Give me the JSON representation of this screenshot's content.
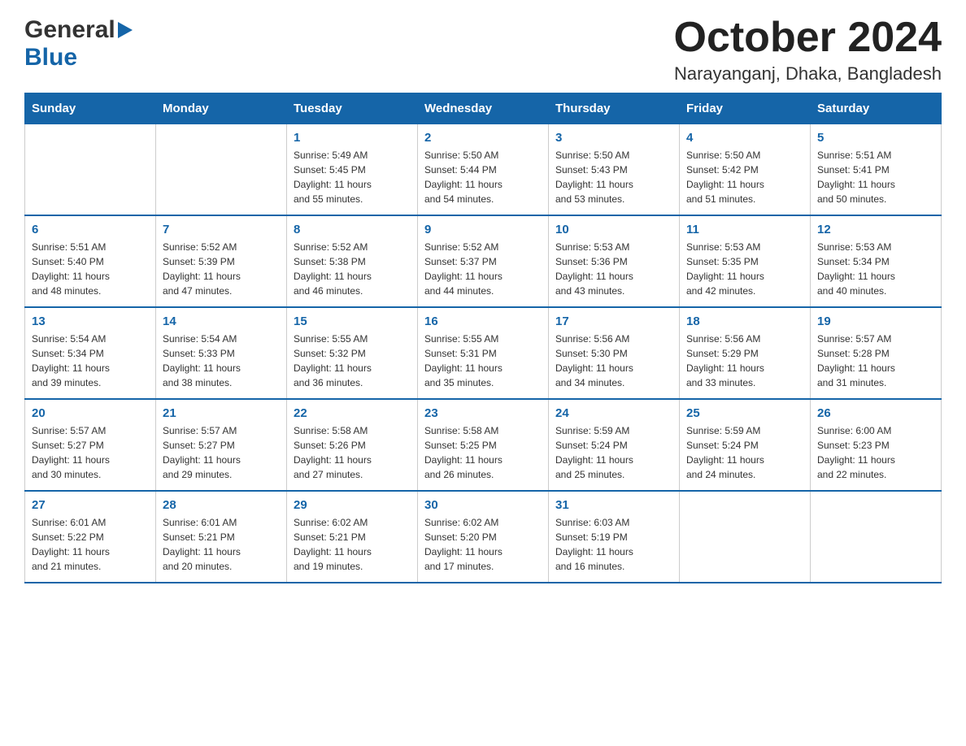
{
  "header": {
    "logo_general": "General",
    "logo_blue": "Blue",
    "month_title": "October 2024",
    "location": "Narayanganj, Dhaka, Bangladesh"
  },
  "weekdays": [
    "Sunday",
    "Monday",
    "Tuesday",
    "Wednesday",
    "Thursday",
    "Friday",
    "Saturday"
  ],
  "weeks": [
    [
      {
        "day": "",
        "info": ""
      },
      {
        "day": "",
        "info": ""
      },
      {
        "day": "1",
        "info": "Sunrise: 5:49 AM\nSunset: 5:45 PM\nDaylight: 11 hours\nand 55 minutes."
      },
      {
        "day": "2",
        "info": "Sunrise: 5:50 AM\nSunset: 5:44 PM\nDaylight: 11 hours\nand 54 minutes."
      },
      {
        "day": "3",
        "info": "Sunrise: 5:50 AM\nSunset: 5:43 PM\nDaylight: 11 hours\nand 53 minutes."
      },
      {
        "day": "4",
        "info": "Sunrise: 5:50 AM\nSunset: 5:42 PM\nDaylight: 11 hours\nand 51 minutes."
      },
      {
        "day": "5",
        "info": "Sunrise: 5:51 AM\nSunset: 5:41 PM\nDaylight: 11 hours\nand 50 minutes."
      }
    ],
    [
      {
        "day": "6",
        "info": "Sunrise: 5:51 AM\nSunset: 5:40 PM\nDaylight: 11 hours\nand 48 minutes."
      },
      {
        "day": "7",
        "info": "Sunrise: 5:52 AM\nSunset: 5:39 PM\nDaylight: 11 hours\nand 47 minutes."
      },
      {
        "day": "8",
        "info": "Sunrise: 5:52 AM\nSunset: 5:38 PM\nDaylight: 11 hours\nand 46 minutes."
      },
      {
        "day": "9",
        "info": "Sunrise: 5:52 AM\nSunset: 5:37 PM\nDaylight: 11 hours\nand 44 minutes."
      },
      {
        "day": "10",
        "info": "Sunrise: 5:53 AM\nSunset: 5:36 PM\nDaylight: 11 hours\nand 43 minutes."
      },
      {
        "day": "11",
        "info": "Sunrise: 5:53 AM\nSunset: 5:35 PM\nDaylight: 11 hours\nand 42 minutes."
      },
      {
        "day": "12",
        "info": "Sunrise: 5:53 AM\nSunset: 5:34 PM\nDaylight: 11 hours\nand 40 minutes."
      }
    ],
    [
      {
        "day": "13",
        "info": "Sunrise: 5:54 AM\nSunset: 5:34 PM\nDaylight: 11 hours\nand 39 minutes."
      },
      {
        "day": "14",
        "info": "Sunrise: 5:54 AM\nSunset: 5:33 PM\nDaylight: 11 hours\nand 38 minutes."
      },
      {
        "day": "15",
        "info": "Sunrise: 5:55 AM\nSunset: 5:32 PM\nDaylight: 11 hours\nand 36 minutes."
      },
      {
        "day": "16",
        "info": "Sunrise: 5:55 AM\nSunset: 5:31 PM\nDaylight: 11 hours\nand 35 minutes."
      },
      {
        "day": "17",
        "info": "Sunrise: 5:56 AM\nSunset: 5:30 PM\nDaylight: 11 hours\nand 34 minutes."
      },
      {
        "day": "18",
        "info": "Sunrise: 5:56 AM\nSunset: 5:29 PM\nDaylight: 11 hours\nand 33 minutes."
      },
      {
        "day": "19",
        "info": "Sunrise: 5:57 AM\nSunset: 5:28 PM\nDaylight: 11 hours\nand 31 minutes."
      }
    ],
    [
      {
        "day": "20",
        "info": "Sunrise: 5:57 AM\nSunset: 5:27 PM\nDaylight: 11 hours\nand 30 minutes."
      },
      {
        "day": "21",
        "info": "Sunrise: 5:57 AM\nSunset: 5:27 PM\nDaylight: 11 hours\nand 29 minutes."
      },
      {
        "day": "22",
        "info": "Sunrise: 5:58 AM\nSunset: 5:26 PM\nDaylight: 11 hours\nand 27 minutes."
      },
      {
        "day": "23",
        "info": "Sunrise: 5:58 AM\nSunset: 5:25 PM\nDaylight: 11 hours\nand 26 minutes."
      },
      {
        "day": "24",
        "info": "Sunrise: 5:59 AM\nSunset: 5:24 PM\nDaylight: 11 hours\nand 25 minutes."
      },
      {
        "day": "25",
        "info": "Sunrise: 5:59 AM\nSunset: 5:24 PM\nDaylight: 11 hours\nand 24 minutes."
      },
      {
        "day": "26",
        "info": "Sunrise: 6:00 AM\nSunset: 5:23 PM\nDaylight: 11 hours\nand 22 minutes."
      }
    ],
    [
      {
        "day": "27",
        "info": "Sunrise: 6:01 AM\nSunset: 5:22 PM\nDaylight: 11 hours\nand 21 minutes."
      },
      {
        "day": "28",
        "info": "Sunrise: 6:01 AM\nSunset: 5:21 PM\nDaylight: 11 hours\nand 20 minutes."
      },
      {
        "day": "29",
        "info": "Sunrise: 6:02 AM\nSunset: 5:21 PM\nDaylight: 11 hours\nand 19 minutes."
      },
      {
        "day": "30",
        "info": "Sunrise: 6:02 AM\nSunset: 5:20 PM\nDaylight: 11 hours\nand 17 minutes."
      },
      {
        "day": "31",
        "info": "Sunrise: 6:03 AM\nSunset: 5:19 PM\nDaylight: 11 hours\nand 16 minutes."
      },
      {
        "day": "",
        "info": ""
      },
      {
        "day": "",
        "info": ""
      }
    ]
  ]
}
